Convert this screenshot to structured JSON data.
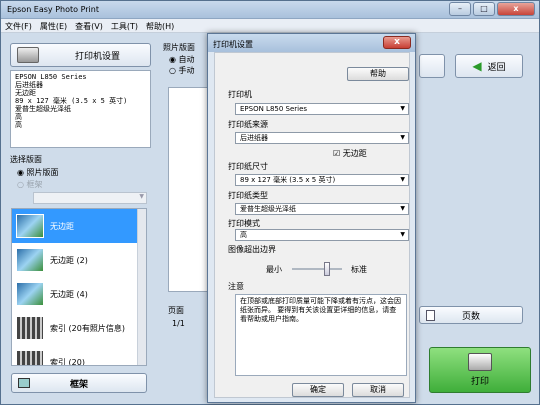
{
  "app": {
    "title": "Epson Easy Photo Print"
  },
  "window_buttons": {
    "min": "–",
    "max": "□",
    "close": "x"
  },
  "menu": [
    "文件(F)",
    "属性(E)",
    "查看(V)",
    "工具(T)",
    "帮助(H)"
  ],
  "left": {
    "printer_settings_label": "打印机设置",
    "printer_info": [
      "EPSON L850 Series",
      "后进纸器",
      "无边距",
      "89 x 127 毫米 (3.5 x 5 英寸)",
      "爱普生超级光泽纸",
      "高",
      "高"
    ],
    "layout_section": "选择版面",
    "radio_photo": "照片版面",
    "radio_frame": "框架",
    "layouts": [
      "无边距",
      "无边距 (2)",
      "无边距 (4)",
      "索引 (20有照片信息)",
      "索引 (20)"
    ],
    "frame_button": "框架"
  },
  "center": {
    "photo_layout_label": "照片版面",
    "auto": "自动",
    "manual": "手动",
    "page_label": "页面",
    "page_value": "1/1"
  },
  "right": {
    "back_button": "返回",
    "pages_button": "页数",
    "print_button": "打印"
  },
  "dialog": {
    "title": "打印机设置",
    "close": "x",
    "help_button": "帮助",
    "printer_label": "打印机",
    "printer_value": "EPSON L850 Series",
    "source_label": "打印纸来源",
    "source_value": "后进纸器",
    "borderless_label": "无边距",
    "size_label": "打印纸尺寸",
    "size_value": "89 x 127 毫米 (3.5 x 5 英寸)",
    "type_label": "打印纸类型",
    "type_value": "爱普生超级光泽纸",
    "mode_label": "打印模式",
    "mode_value": "高",
    "expansion_label": "图像超出边界",
    "min_label": "最小",
    "std_label": "标准",
    "expansion_level": 0.7,
    "note_label": "注意",
    "note_text": "在顶部或底部打印质量可能下降或着有污点，这会因纸张而异。 要得到有关该设置更详细的信息，请查看帮助或用户指南。",
    "ok_button": "确定",
    "cancel_button": "取消"
  }
}
